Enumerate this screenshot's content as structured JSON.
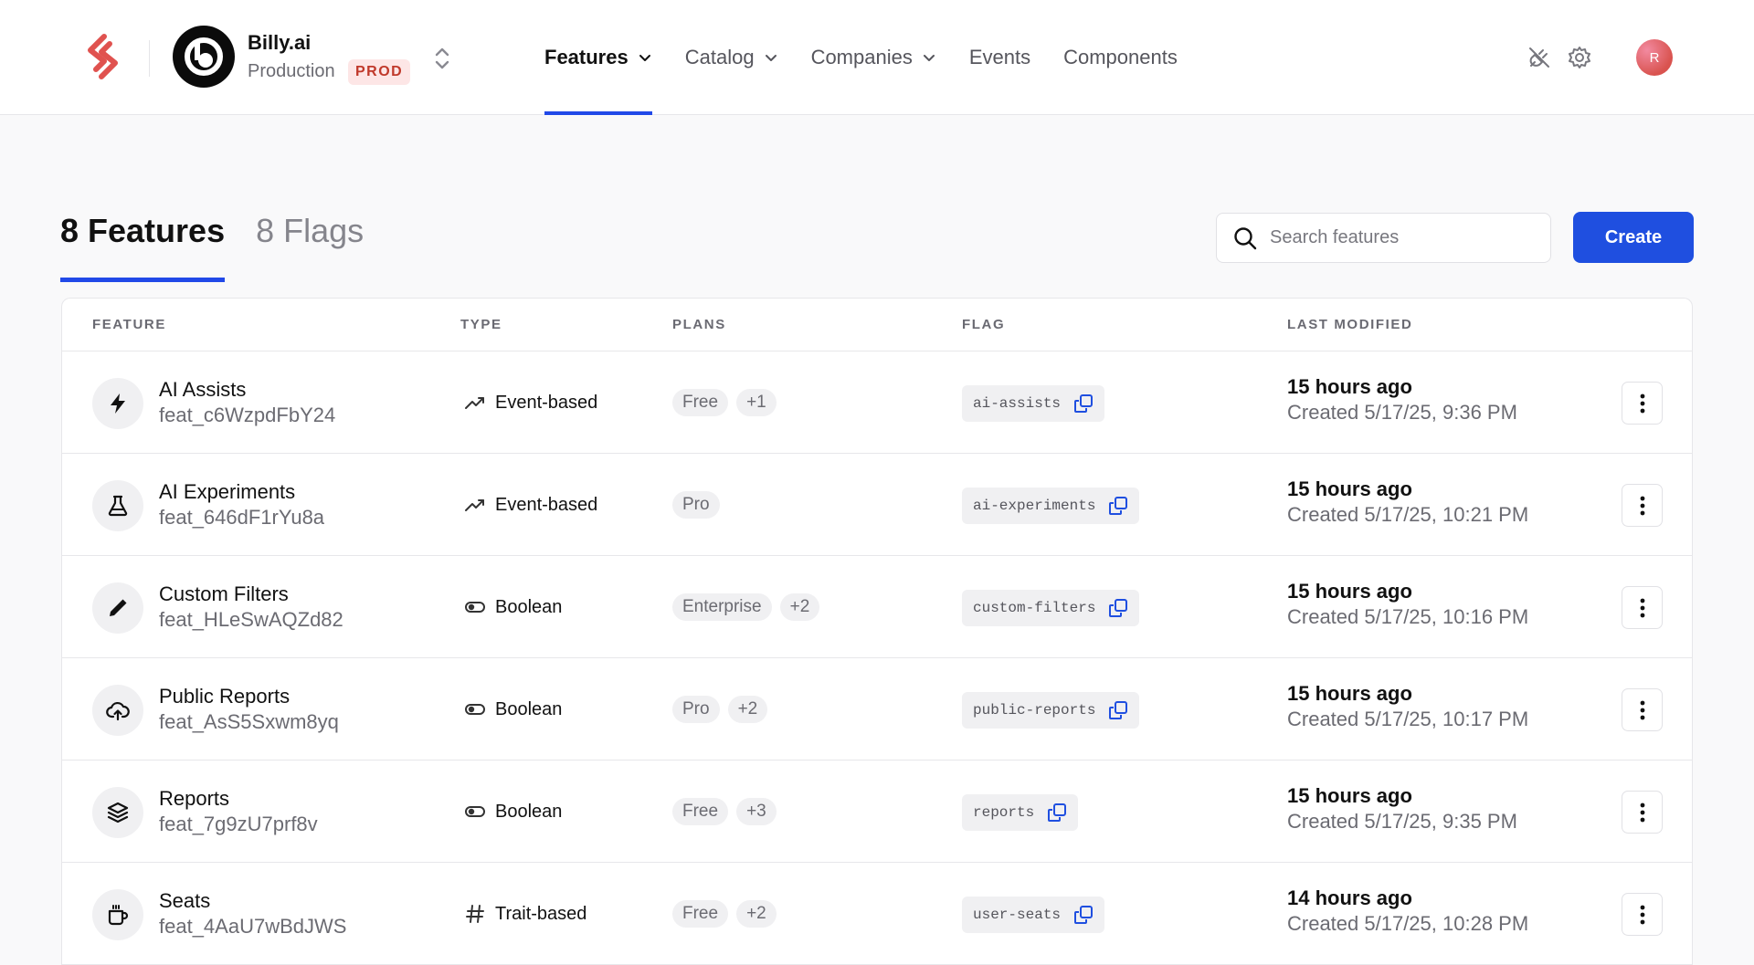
{
  "org": {
    "name": "Billy.ai",
    "environment": "Production",
    "env_badge": "PROD",
    "avatar_letter": "b"
  },
  "nav": [
    {
      "label": "Features",
      "has_dropdown": true,
      "active": true
    },
    {
      "label": "Catalog",
      "has_dropdown": true,
      "active": false
    },
    {
      "label": "Companies",
      "has_dropdown": true,
      "active": false
    },
    {
      "label": "Events",
      "has_dropdown": false,
      "active": false
    },
    {
      "label": "Components",
      "has_dropdown": false,
      "active": false
    }
  ],
  "user": {
    "initial": "R"
  },
  "tabs": {
    "features": "8 Features",
    "flags": "8 Flags"
  },
  "search": {
    "placeholder": "Search features"
  },
  "create_label": "Create",
  "columns": {
    "feature": "FEATURE",
    "type": "TYPE",
    "plans": "PLANS",
    "flag": "FLAG",
    "last_modified": "LAST MODIFIED"
  },
  "colors": {
    "accent": "#1f4fe0",
    "prod_badge_bg": "#fde6e6",
    "prod_badge_text": "#c0392b"
  },
  "rows": [
    {
      "name": "AI Assists",
      "id": "feat_c6WzpdFbY24",
      "icon": "bolt-icon",
      "type": "Event-based",
      "type_icon": "trend-icon",
      "plans": [
        "Free",
        "+1"
      ],
      "flag": "ai-assists",
      "modified": "15 hours ago",
      "created": "Created 5/17/25, 9:36 PM"
    },
    {
      "name": "AI Experiments",
      "id": "feat_646dF1rYu8a",
      "icon": "flask-icon",
      "type": "Event-based",
      "type_icon": "trend-icon",
      "plans": [
        "Pro"
      ],
      "flag": "ai-experiments",
      "modified": "15 hours ago",
      "created": "Created 5/17/25, 10:21 PM"
    },
    {
      "name": "Custom Filters",
      "id": "feat_HLeSwAQZd82",
      "icon": "pencil-icon",
      "type": "Boolean",
      "type_icon": "toggle-icon",
      "plans": [
        "Enterprise",
        "+2"
      ],
      "flag": "custom-filters",
      "modified": "15 hours ago",
      "created": "Created 5/17/25, 10:16 PM"
    },
    {
      "name": "Public Reports",
      "id": "feat_AsS5Sxwm8yq",
      "icon": "cloud-upload-icon",
      "type": "Boolean",
      "type_icon": "toggle-icon",
      "plans": [
        "Pro",
        "+2"
      ],
      "flag": "public-reports",
      "modified": "15 hours ago",
      "created": "Created 5/17/25, 10:17 PM"
    },
    {
      "name": "Reports",
      "id": "feat_7g9zU7prf8v",
      "icon": "layers-icon",
      "type": "Boolean",
      "type_icon": "toggle-icon",
      "plans": [
        "Free",
        "+3"
      ],
      "flag": "reports",
      "modified": "15 hours ago",
      "created": "Created 5/17/25, 9:35 PM"
    },
    {
      "name": "Seats",
      "id": "feat_4AaU7wBdJWS",
      "icon": "mug-icon",
      "type": "Trait-based",
      "type_icon": "hash-icon",
      "plans": [
        "Free",
        "+2"
      ],
      "flag": "user-seats",
      "modified": "14 hours ago",
      "created": "Created 5/17/25, 10:28 PM"
    }
  ]
}
